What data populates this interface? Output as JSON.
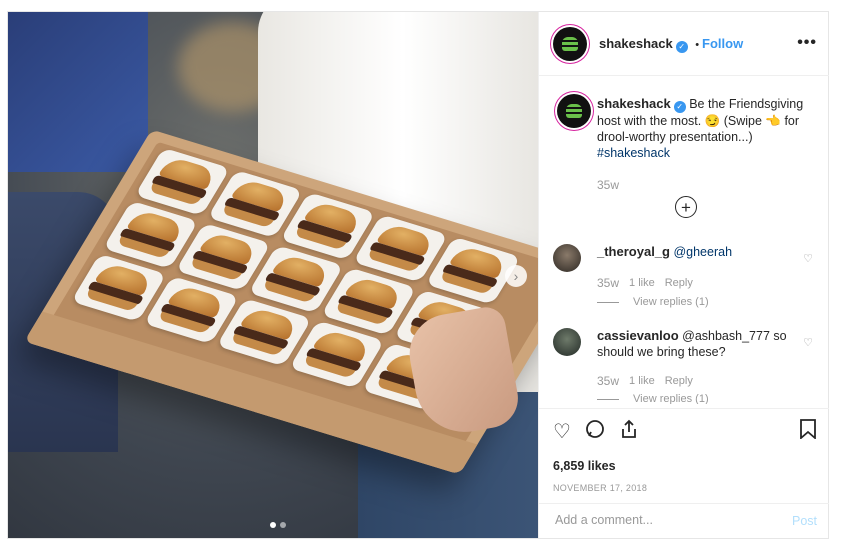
{
  "post": {
    "username": "shakeshack",
    "separator": "•",
    "follow_label": "Follow",
    "more_label": "•••",
    "caption": {
      "username": "shakeshack",
      "text": "Be the Friendsgiving host with the most. 😏 (Swipe 👈 for drool-worthy presentation...)",
      "hashtag": "#shakeshack",
      "time": "35w"
    },
    "load_more_label": "+",
    "comments": [
      {
        "username": "_theroyal_g",
        "text": "@gheerah",
        "time": "35w",
        "likes": "1 like",
        "reply_label": "Reply",
        "view_replies": "View replies (1)"
      },
      {
        "username": "cassievanloo",
        "text": "@ashbash_777 so should we bring these?",
        "time": "35w",
        "likes": "1 like",
        "reply_label": "Reply",
        "view_replies": "View replies (1)"
      }
    ],
    "likes_count": "6,859 likes",
    "date": "NOVEMBER 17, 2018",
    "add_comment_placeholder": "Add a comment...",
    "post_label": "Post"
  },
  "colors": {
    "accent": "#3897f0",
    "hashtag": "#003569",
    "muted": "#999999"
  },
  "icons": [
    "heart-icon",
    "comment-icon",
    "share-icon",
    "bookmark-icon",
    "verified-icon",
    "next-arrow-icon",
    "plus-circle-icon"
  ]
}
